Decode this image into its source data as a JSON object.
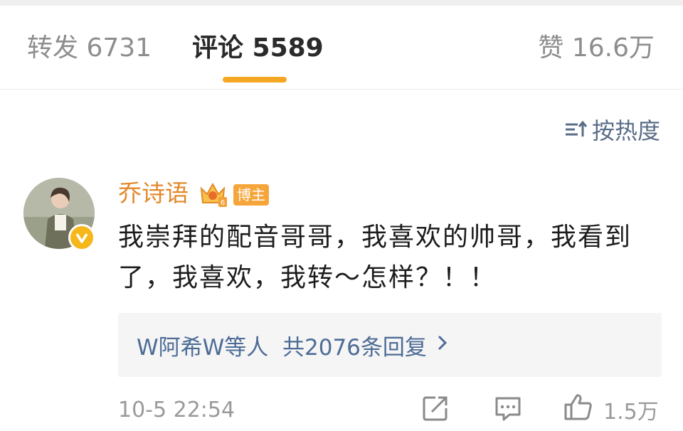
{
  "tabs": {
    "repost": "转发 6731",
    "comment": "评论 5589",
    "like": "赞 16.6万",
    "accent_color": "#f5a623"
  },
  "sort": {
    "label": "按热度",
    "icon": "sort-icon"
  },
  "comment": {
    "username": "乔诗语",
    "owner_tag": "博主",
    "badges": [
      "crown-icon",
      "verified-icon"
    ],
    "text": "我崇拜的配音哥哥，我喜欢的帅哥，我看到了，我喜欢，我转～怎样？！！",
    "replies_label": "W阿希W等人  共2076条回复",
    "timestamp": "10-5 22:54",
    "like_count": "1.5万",
    "actions": [
      "share-icon",
      "reply-icon",
      "like-icon"
    ]
  }
}
